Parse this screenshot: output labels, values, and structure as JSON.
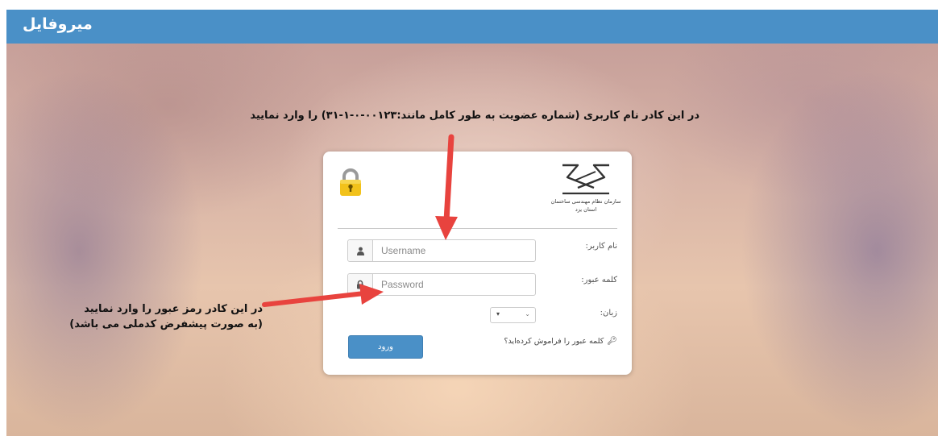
{
  "header": {
    "brand": "میروفایل",
    "bar_color": "#4a90c7"
  },
  "annotations": {
    "username_hint": "در این کادر نام کاربری (شماره عضویت به طور کامل مانند:۰۰۱۲۳-۰-۱-۳۱) را وارد نمایید",
    "password_hint_line1": "در این کادر رمز عبور را وارد نمایید",
    "password_hint_line2": "(به صورت پیشفرض کدملی می باشد)",
    "arrow_color": "#e8433e"
  },
  "login": {
    "org_name_line1": "سازمان نظام مهندسی ساختمان",
    "org_name_line2": "استان یزد",
    "username_label": "نام کاربر:",
    "username_placeholder": "Username",
    "username_value": "",
    "password_label": "کلمه عبور:",
    "password_placeholder": "Password",
    "password_value": "",
    "language_label": "زبان:",
    "language_selected": "▾",
    "forgot_password": "کلمه عبور را فراموش کرده‌اید؟",
    "submit_label": "ورود",
    "icons": {
      "lock": "lock-icon",
      "user": "user-icon",
      "password_lock": "lock-icon",
      "key": "key-icon",
      "logo": "handshake-logo"
    }
  }
}
